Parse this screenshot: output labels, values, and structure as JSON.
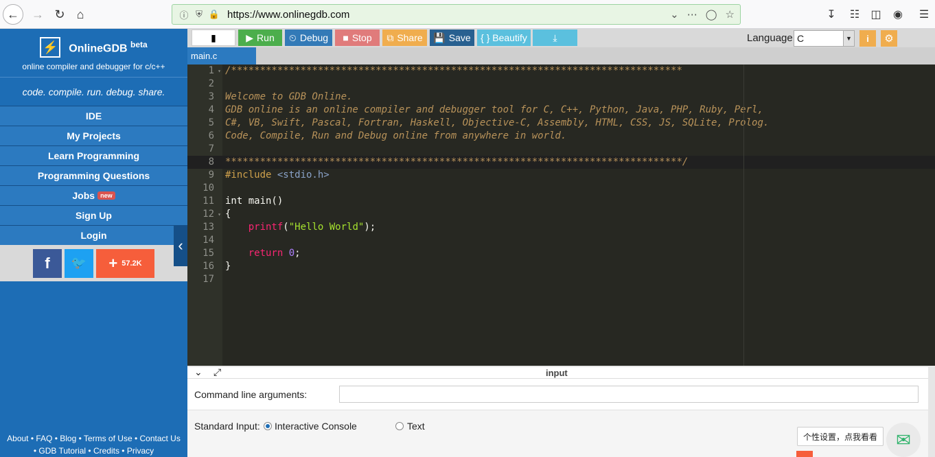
{
  "browser": {
    "url": "https://www.onlinegdb.com"
  },
  "sidebar": {
    "brand_name": "OnlineGDB",
    "brand_beta": "beta",
    "brand_sub": "online compiler and debugger for c/c++",
    "tagline": "code. compile. run. debug. share.",
    "items": [
      {
        "label": "IDE"
      },
      {
        "label": "My Projects"
      },
      {
        "label": "Learn Programming"
      },
      {
        "label": "Programming Questions"
      },
      {
        "label": "Jobs",
        "badge": "new"
      },
      {
        "label": "Sign Up"
      },
      {
        "label": "Login"
      }
    ],
    "share_count": "57.2K",
    "footer_line1": "About • FAQ • Blog • Terms of Use • Contact Us",
    "footer_line2": "• GDB Tutorial • Credits • Privacy"
  },
  "toolbar": {
    "run": "Run",
    "debug": "Debug",
    "stop": "Stop",
    "share": "Share",
    "save": "Save",
    "beautify": "{ } Beautify",
    "language_label": "Language",
    "language_value": "C"
  },
  "file_tab": "main.c",
  "code_lines": [
    "1",
    "2",
    "3",
    "4",
    "5",
    "6",
    "7",
    "8",
    "9",
    "10",
    "11",
    "12",
    "13",
    "14",
    "15",
    "16",
    "17"
  ],
  "code": {
    "l1": "/******************************************************************************",
    "l3": "Welcome to GDB Online.",
    "l4": "GDB online is an online compiler and debugger tool for C, C++, Python, Java, PHP, Ruby, Perl,",
    "l5": "C#, VB, Swift, Pascal, Fortran, Haskell, Objective-C, Assembly, HTML, CSS, JS, SQLite, Prolog.",
    "l6": "Code, Compile, Run and Debug online from anywhere in world.",
    "l8": "*******************************************************************************/",
    "l9a": "#include ",
    "l9b": "<stdio.h>",
    "l11": "int main()",
    "l12": "{",
    "l13a": "printf",
    "l13b": "(",
    "l13c": "\"Hello World\"",
    "l13d": ");",
    "l15a": "return ",
    "l15b": "0",
    "l15c": ";",
    "l16": "}"
  },
  "input_panel": {
    "title": "input",
    "cla_label": "Command line arguments:",
    "std_label": "Standard Input:",
    "opt_interactive": "Interactive Console",
    "opt_text": "Text",
    "selected": "Interactive Console"
  },
  "widgets": {
    "tooltip": "个性设置，点我看看"
  },
  "colors": {
    "sidebar_bg": "#1d6db5",
    "editor_bg": "#272822",
    "run": "#4cae4c",
    "debug": "#337ab7",
    "stop": "#e07b7b",
    "share": "#f0ad4e",
    "save": "#286090",
    "beautify": "#5bc0de"
  }
}
